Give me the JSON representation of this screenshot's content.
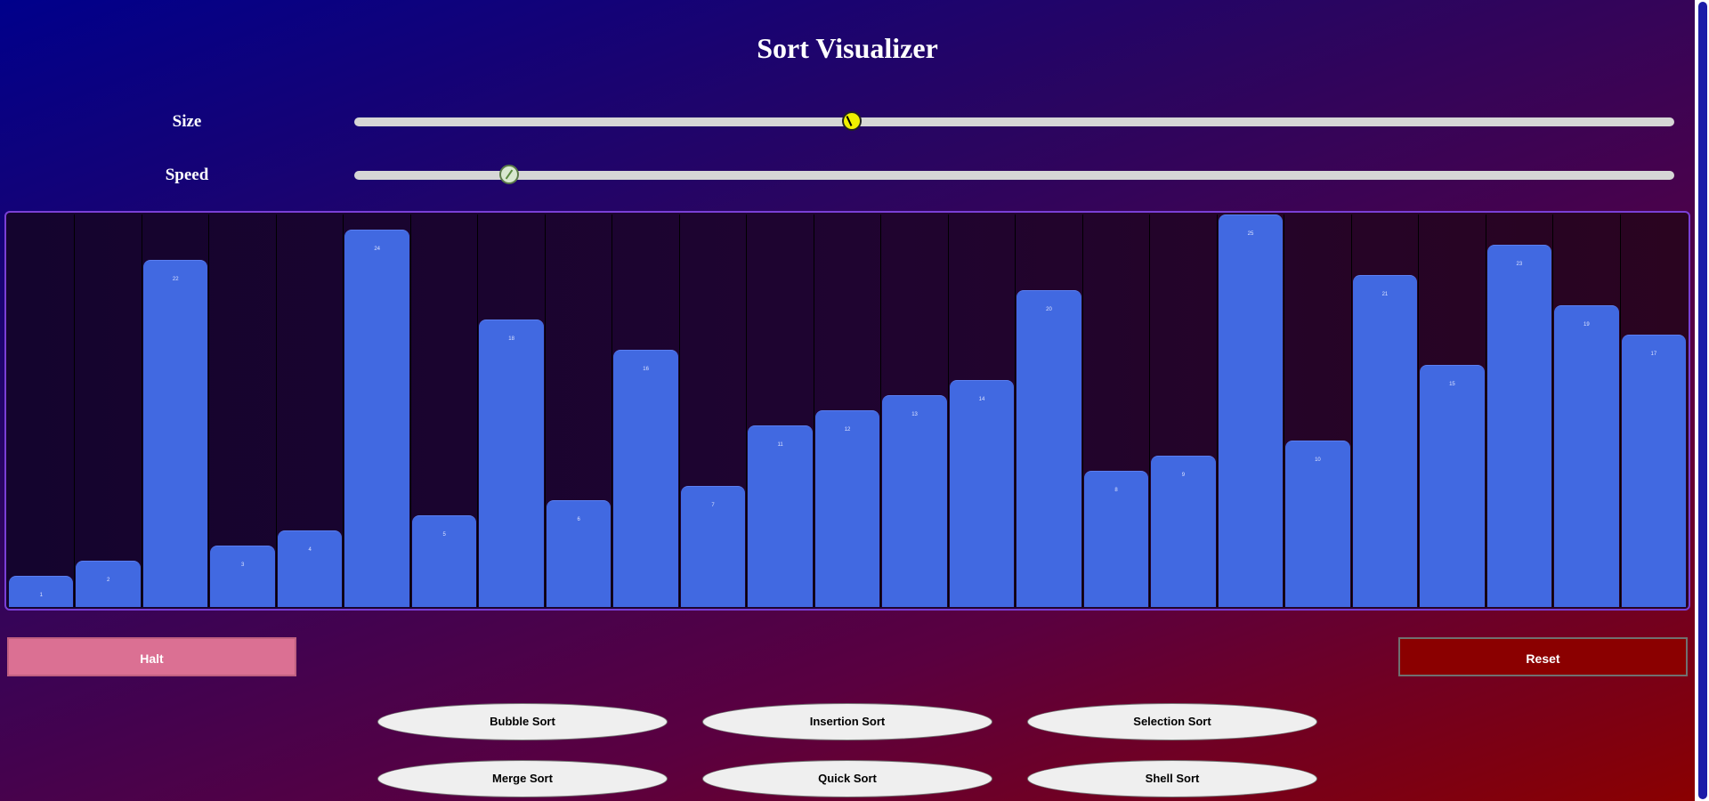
{
  "title": "Sort Visualizer",
  "sliders": {
    "size": {
      "label": "Size",
      "value_fraction": 0.377
    },
    "speed": {
      "label": "Speed",
      "value_fraction": 0.117
    }
  },
  "bars": [
    {
      "value": 1,
      "label": "1"
    },
    {
      "value": 2,
      "label": "2"
    },
    {
      "value": 22,
      "label": "22"
    },
    {
      "value": 3,
      "label": "3"
    },
    {
      "value": 4,
      "label": "4"
    },
    {
      "value": 24,
      "label": "24"
    },
    {
      "value": 5,
      "label": "5"
    },
    {
      "value": 18,
      "label": "18"
    },
    {
      "value": 6,
      "label": "6"
    },
    {
      "value": 16,
      "label": "16"
    },
    {
      "value": 7,
      "label": "7"
    },
    {
      "value": 11,
      "label": "11"
    },
    {
      "value": 12,
      "label": "12"
    },
    {
      "value": 13,
      "label": "13"
    },
    {
      "value": 14,
      "label": "14"
    },
    {
      "value": 20,
      "label": "20"
    },
    {
      "value": 8,
      "label": "8"
    },
    {
      "value": 9,
      "label": "9"
    },
    {
      "value": 25,
      "label": "25"
    },
    {
      "value": 10,
      "label": "10"
    },
    {
      "value": 21,
      "label": "21"
    },
    {
      "value": 15,
      "label": "15"
    },
    {
      "value": 23,
      "label": "23"
    },
    {
      "value": 19,
      "label": "19"
    },
    {
      "value": 17,
      "label": "17"
    }
  ],
  "max_value": 25,
  "controls": {
    "halt_label": "Halt",
    "reset_label": "Reset"
  },
  "algorithms": [
    "Bubble Sort",
    "Insertion Sort",
    "Selection Sort",
    "Merge Sort",
    "Quick Sort",
    "Shell Sort"
  ],
  "colors": {
    "bar": "#4169e1",
    "halt": "#db7093",
    "reset": "#8b0000"
  }
}
